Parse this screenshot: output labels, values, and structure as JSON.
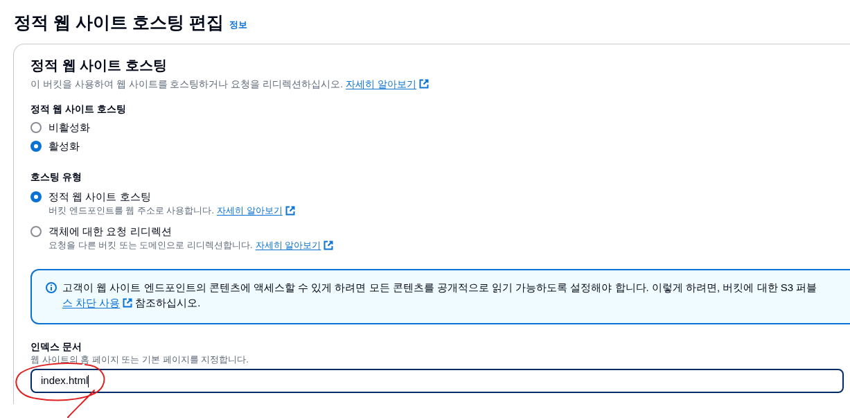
{
  "page": {
    "title": "정적 웹 사이트 호스팅 편집",
    "info_link": "정보"
  },
  "panel": {
    "title": "정적 웹 사이트 호스팅",
    "description": "이 버킷을 사용하여 웹 사이트를 호스팅하거나 요청을 리디렉션하십시오.",
    "link": "자세히 알아보기"
  },
  "hosting_toggle": {
    "label": "정적 웹 사이트 호스팅",
    "options": [
      {
        "label": "비활성화",
        "selected": false
      },
      {
        "label": "활성화",
        "selected": true
      }
    ]
  },
  "hosting_type": {
    "label": "호스팅 유형",
    "options": [
      {
        "label": "정적 웹 사이트 호스팅",
        "selected": true,
        "description": "버킷 엔드포인트를 웹 주소로 사용합니다.",
        "link": "자세히 알아보기"
      },
      {
        "label": "객체에 대한 요청 리디렉션",
        "selected": false,
        "description": "요청을 다른 버킷 또는 도메인으로 리디렉션합니다.",
        "link": "자세히 알아보기"
      }
    ]
  },
  "alert": {
    "text": "고객이 웹 사이트 엔드포인트의 콘텐츠에 액세스할 수 있게 하려면 모든 콘텐츠를 공개적으로 읽기 가능하도록 설정해야 합니다. 이렇게 하려면, 버킷에 대한 S3 퍼블",
    "link": "스 차단 사용",
    "after": "참조하십시오."
  },
  "index_document": {
    "label": "인덱스 문서",
    "hint": "웹 사이트의 홈 페이지 또는 기본 페이지를 지정합니다.",
    "value": "index.html"
  }
}
